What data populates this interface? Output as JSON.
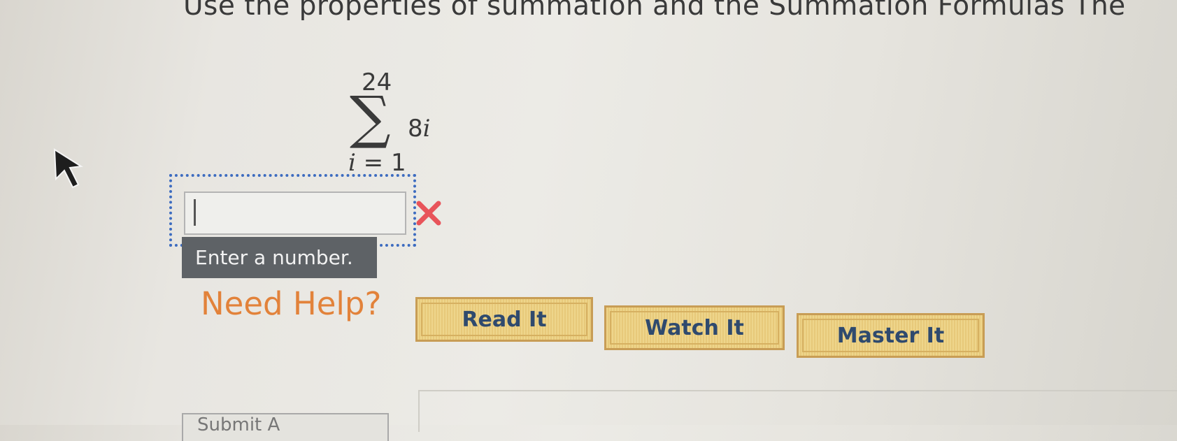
{
  "question": {
    "text": "Use the properties of summation and the Summation Formulas The"
  },
  "summation": {
    "upper": "24",
    "sigma": "∑",
    "term_coefficient": "8",
    "term_variable": "i",
    "lower_variable": "i",
    "lower_value": " = 1"
  },
  "answer": {
    "value": "",
    "status": "incorrect",
    "status_icon": "x-mark-icon",
    "tooltip": "Enter a number."
  },
  "help": {
    "title": "Need Help?",
    "buttons": [
      "Read It",
      "Watch It",
      "Master It"
    ]
  },
  "submit": {
    "label": "Submit A"
  },
  "colors": {
    "help_title": "#e2823a",
    "wrong_mark": "#e8545a",
    "button_text": "#2f4a6e",
    "focus_border": "#3d6cc0"
  }
}
